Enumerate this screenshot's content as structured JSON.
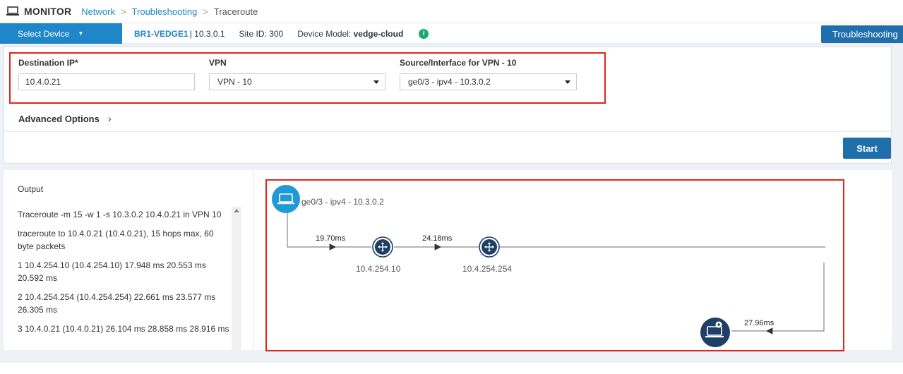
{
  "header": {
    "title": "MONITOR",
    "breadcrumb": [
      "Network",
      "Troubleshooting",
      "Traceroute"
    ],
    "separator": ">"
  },
  "device_bar": {
    "select_label": "Select Device",
    "device_name": "BR1-VEDGE1",
    "device_ip": "| 10.3.0.1",
    "site_id": "Site ID: 300",
    "model_label": "Device Model:",
    "model_value": "vedge-cloud",
    "troubleshooting_label": "Troubleshooting"
  },
  "form": {
    "destination_ip": {
      "label": "Destination IP*",
      "value": "10.4.0.21"
    },
    "vpn": {
      "label": "VPN",
      "value": "VPN - 10"
    },
    "source_interface": {
      "label": "Source/Interface for VPN - 10",
      "value": "ge0/3 - ipv4 - 10.3.0.2"
    },
    "advanced_options": "Advanced Options",
    "start_label": "Start"
  },
  "output": {
    "title": "Output",
    "lines": [
      "Traceroute -m 15 -w 1 -s 10.3.0.2 10.4.0.21 in VPN 10",
      "traceroute to 10.4.0.21 (10.4.0.21), 15 hops max, 60 byte packets",
      "1 10.4.254.10 (10.4.254.10) 17.948 ms 20.553 ms 20.592 ms",
      "2 10.4.254.254 (10.4.254.254) 22.661 ms 23.577 ms 26.305 ms",
      "3 10.4.0.21 (10.4.0.21) 26.104 ms 28.858 ms 28.916 ms"
    ]
  },
  "diagram": {
    "source_label": "ge0/3 - ipv4 - 10.3.0.2",
    "hops": [
      {
        "ip": "10.4.254.10",
        "latency": "19.70ms"
      },
      {
        "ip": "10.4.254.254",
        "latency": "24.18ms"
      }
    ],
    "final_latency": "27.96ms"
  },
  "colors": {
    "accent": "#1f86c9",
    "highlight": "#e2231a",
    "router": "#1e3f66",
    "info": "#19a974"
  }
}
